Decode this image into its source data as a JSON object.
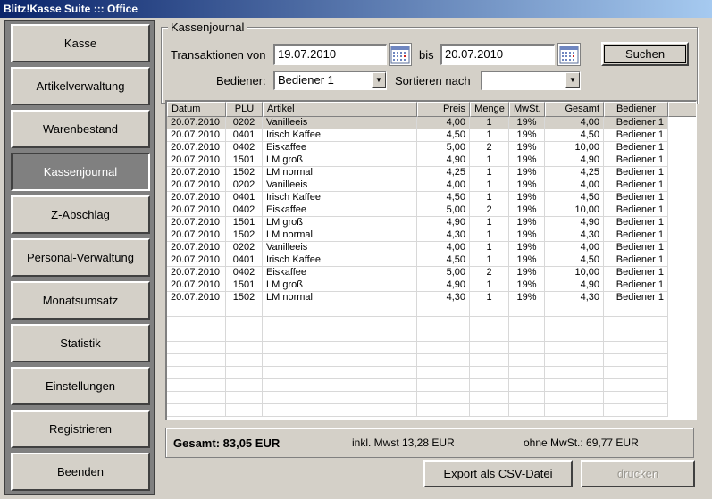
{
  "window": {
    "title": "Blitz!Kasse Suite ::: Office"
  },
  "sidebar": {
    "items": [
      {
        "label": "Kasse",
        "name": "sidebar-item-kasse"
      },
      {
        "label": "Artikelverwaltung",
        "name": "sidebar-item-artikelverwaltung"
      },
      {
        "label": "Warenbestand",
        "name": "sidebar-item-warenbestand"
      },
      {
        "label": "Kassenjournal",
        "name": "sidebar-item-kassenjournal",
        "active": true
      },
      {
        "label": "Z-Abschlag",
        "name": "sidebar-item-z-abschlag"
      },
      {
        "label": "Personal-Verwaltung",
        "name": "sidebar-item-personal-verwaltung"
      },
      {
        "label": "Monatsumsatz",
        "name": "sidebar-item-monatsumsatz"
      },
      {
        "label": "Statistik",
        "name": "sidebar-item-statistik"
      },
      {
        "label": "Einstellungen",
        "name": "sidebar-item-einstellungen"
      },
      {
        "label": "Registrieren",
        "name": "sidebar-item-registrieren"
      },
      {
        "label": "Beenden",
        "name": "sidebar-item-beenden"
      }
    ]
  },
  "filters": {
    "group_title": "Kassenjournal",
    "from_label": "Transaktionen von",
    "from_value": "19.07.2010",
    "to_label": "bis",
    "to_value": "20.07.2010",
    "search_button": "Suchen",
    "operator_label": "Bediener:",
    "operator_value": "Bediener 1",
    "sort_label": "Sortieren nach",
    "sort_value": ""
  },
  "table": {
    "columns": [
      "Datum",
      "PLU",
      "Artikel",
      "Preis",
      "Menge",
      "MwSt.",
      "Gesamt",
      "Bediener"
    ],
    "rows": [
      [
        "20.07.2010",
        "0202",
        "Vanilleeis",
        "4,00",
        "1",
        "19%",
        "4,00",
        "Bediener 1"
      ],
      [
        "20.07.2010",
        "0401",
        "Irisch Kaffee",
        "4,50",
        "1",
        "19%",
        "4,50",
        "Bediener 1"
      ],
      [
        "20.07.2010",
        "0402",
        "Eiskaffee",
        "5,00",
        "2",
        "19%",
        "10,00",
        "Bediener 1"
      ],
      [
        "20.07.2010",
        "1501",
        "LM groß",
        "4,90",
        "1",
        "19%",
        "4,90",
        "Bediener 1"
      ],
      [
        "20.07.2010",
        "1502",
        "LM normal",
        "4,25",
        "1",
        "19%",
        "4,25",
        "Bediener 1"
      ],
      [
        "20.07.2010",
        "0202",
        "Vanilleeis",
        "4,00",
        "1",
        "19%",
        "4,00",
        "Bediener 1"
      ],
      [
        "20.07.2010",
        "0401",
        "Irisch Kaffee",
        "4,50",
        "1",
        "19%",
        "4,50",
        "Bediener 1"
      ],
      [
        "20.07.2010",
        "0402",
        "Eiskaffee",
        "5,00",
        "2",
        "19%",
        "10,00",
        "Bediener 1"
      ],
      [
        "20.07.2010",
        "1501",
        "LM groß",
        "4,90",
        "1",
        "19%",
        "4,90",
        "Bediener 1"
      ],
      [
        "20.07.2010",
        "1502",
        "LM normal",
        "4,30",
        "1",
        "19%",
        "4,30",
        "Bediener 1"
      ],
      [
        "20.07.2010",
        "0202",
        "Vanilleeis",
        "4,00",
        "1",
        "19%",
        "4,00",
        "Bediener 1"
      ],
      [
        "20.07.2010",
        "0401",
        "Irisch Kaffee",
        "4,50",
        "1",
        "19%",
        "4,50",
        "Bediener 1"
      ],
      [
        "20.07.2010",
        "0402",
        "Eiskaffee",
        "5,00",
        "2",
        "19%",
        "10,00",
        "Bediener 1"
      ],
      [
        "20.07.2010",
        "1501",
        "LM groß",
        "4,90",
        "1",
        "19%",
        "4,90",
        "Bediener 1"
      ],
      [
        "20.07.2010",
        "1502",
        "LM normal",
        "4,30",
        "1",
        "19%",
        "4,30",
        "Bediener 1"
      ]
    ]
  },
  "totals": {
    "total": "Gesamt: 83,05 EUR",
    "incl_tax": "inkl. Mwst 13,28 EUR",
    "net": "ohne MwSt.: 69,77 EUR"
  },
  "actions": {
    "export_button": "Export als CSV-Datei",
    "print_button": "drucken"
  }
}
